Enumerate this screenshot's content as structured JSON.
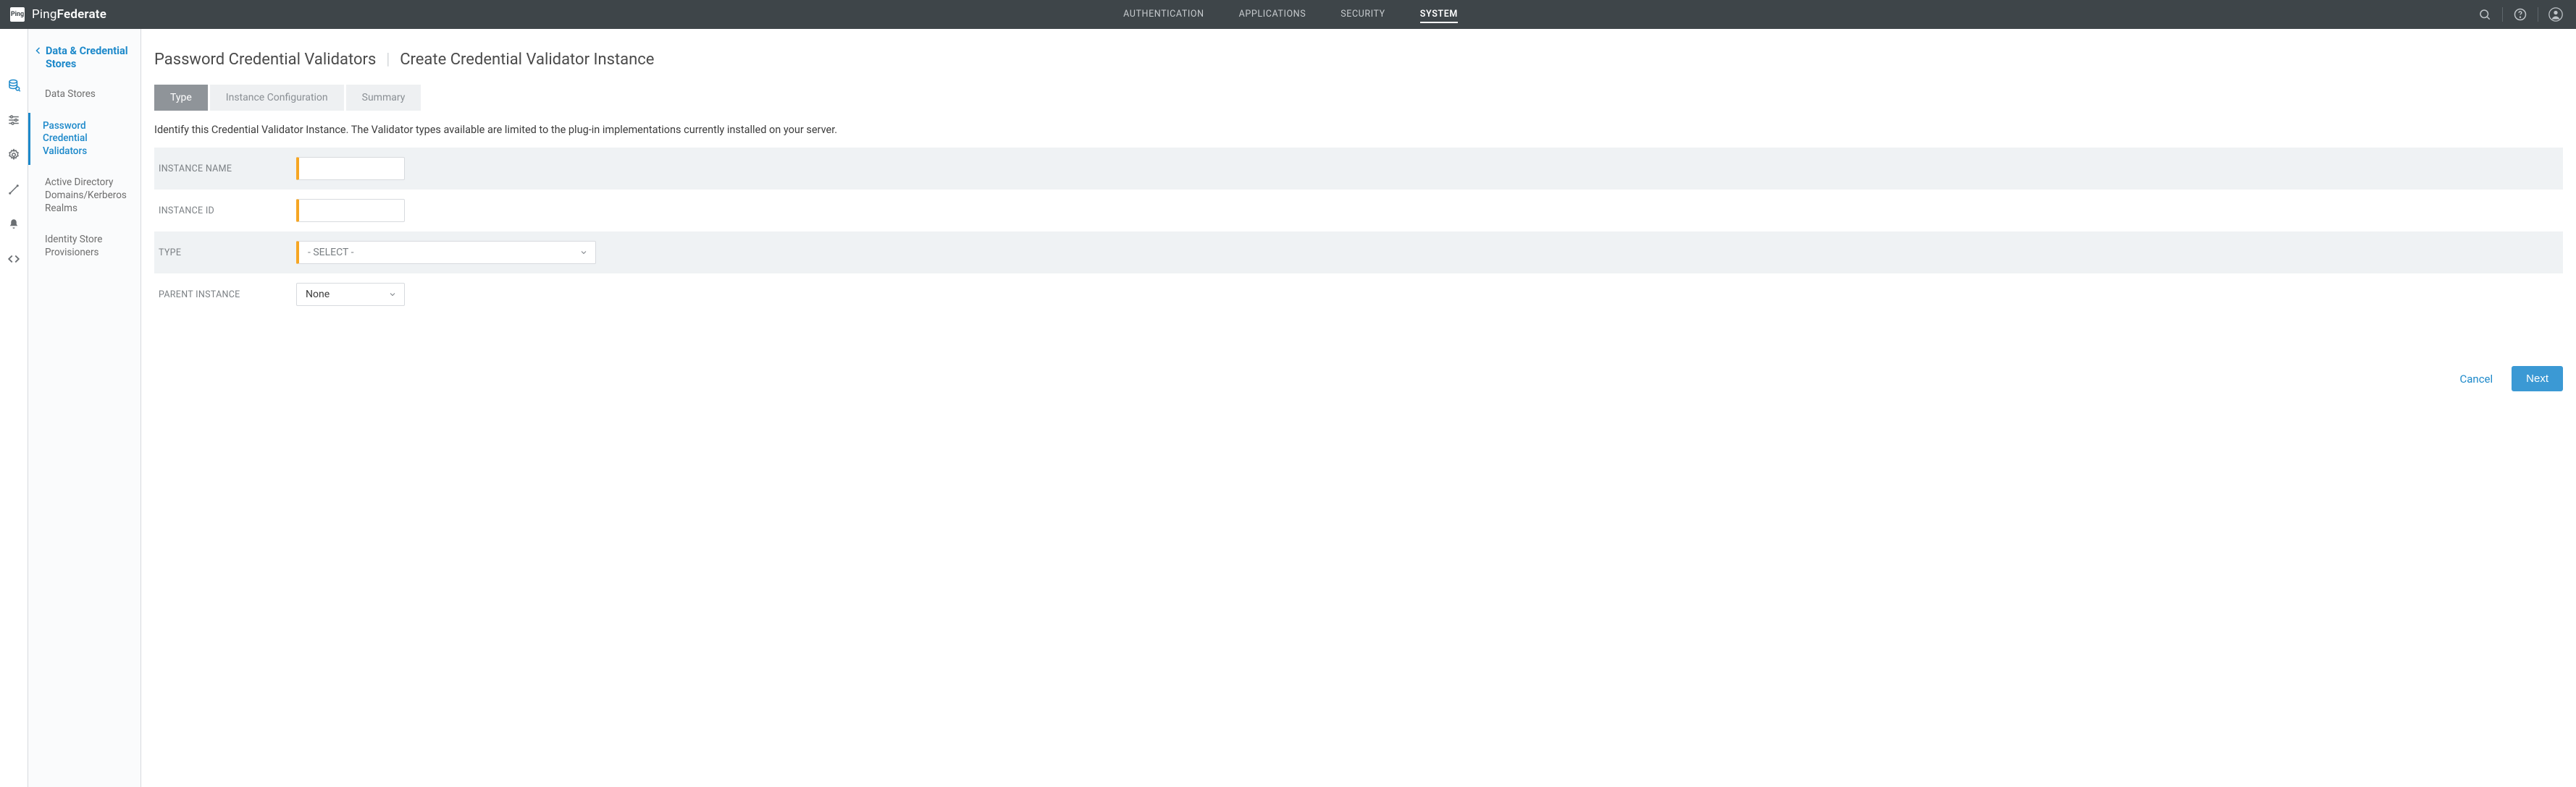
{
  "brand": {
    "logo_text": "Ping",
    "name_prefix": "Ping",
    "name_suffix": "Federate"
  },
  "nav": {
    "items": [
      {
        "label": "AUTHENTICATION"
      },
      {
        "label": "APPLICATIONS"
      },
      {
        "label": "SECURITY"
      },
      {
        "label": "SYSTEM"
      }
    ],
    "active_index": 3
  },
  "sidebar": {
    "heading": "Data & Credential Stores",
    "items": [
      {
        "label": "Data Stores"
      },
      {
        "label": "Password Credential Validators"
      },
      {
        "label": "Active Directory Domains/Kerberos Realms"
      },
      {
        "label": "Identity Store Provisioners"
      }
    ],
    "active_index": 1
  },
  "page": {
    "breadcrumb_parent": "Password Credential Validators",
    "breadcrumb_current": "Create Credential Validator Instance"
  },
  "tabs": {
    "items": [
      {
        "label": "Type"
      },
      {
        "label": "Instance Configuration"
      },
      {
        "label": "Summary"
      }
    ],
    "active_index": 0
  },
  "description": "Identify this Credential Validator Instance. The Validator types available are limited to the plug-in implementations currently installed on your server.",
  "form": {
    "instance_name": {
      "label": "INSTANCE NAME",
      "value": ""
    },
    "instance_id": {
      "label": "INSTANCE ID",
      "value": ""
    },
    "type": {
      "label": "TYPE",
      "selected": "- SELECT -"
    },
    "parent": {
      "label": "PARENT INSTANCE",
      "selected": "None"
    }
  },
  "actions": {
    "cancel": "Cancel",
    "next": "Next"
  },
  "icons": {
    "search": "search-icon",
    "help": "help-icon",
    "user": "user-icon",
    "rail": [
      "database-icon",
      "sliders-icon",
      "gear-icon",
      "tools-icon",
      "bell-icon",
      "code-icon"
    ]
  }
}
